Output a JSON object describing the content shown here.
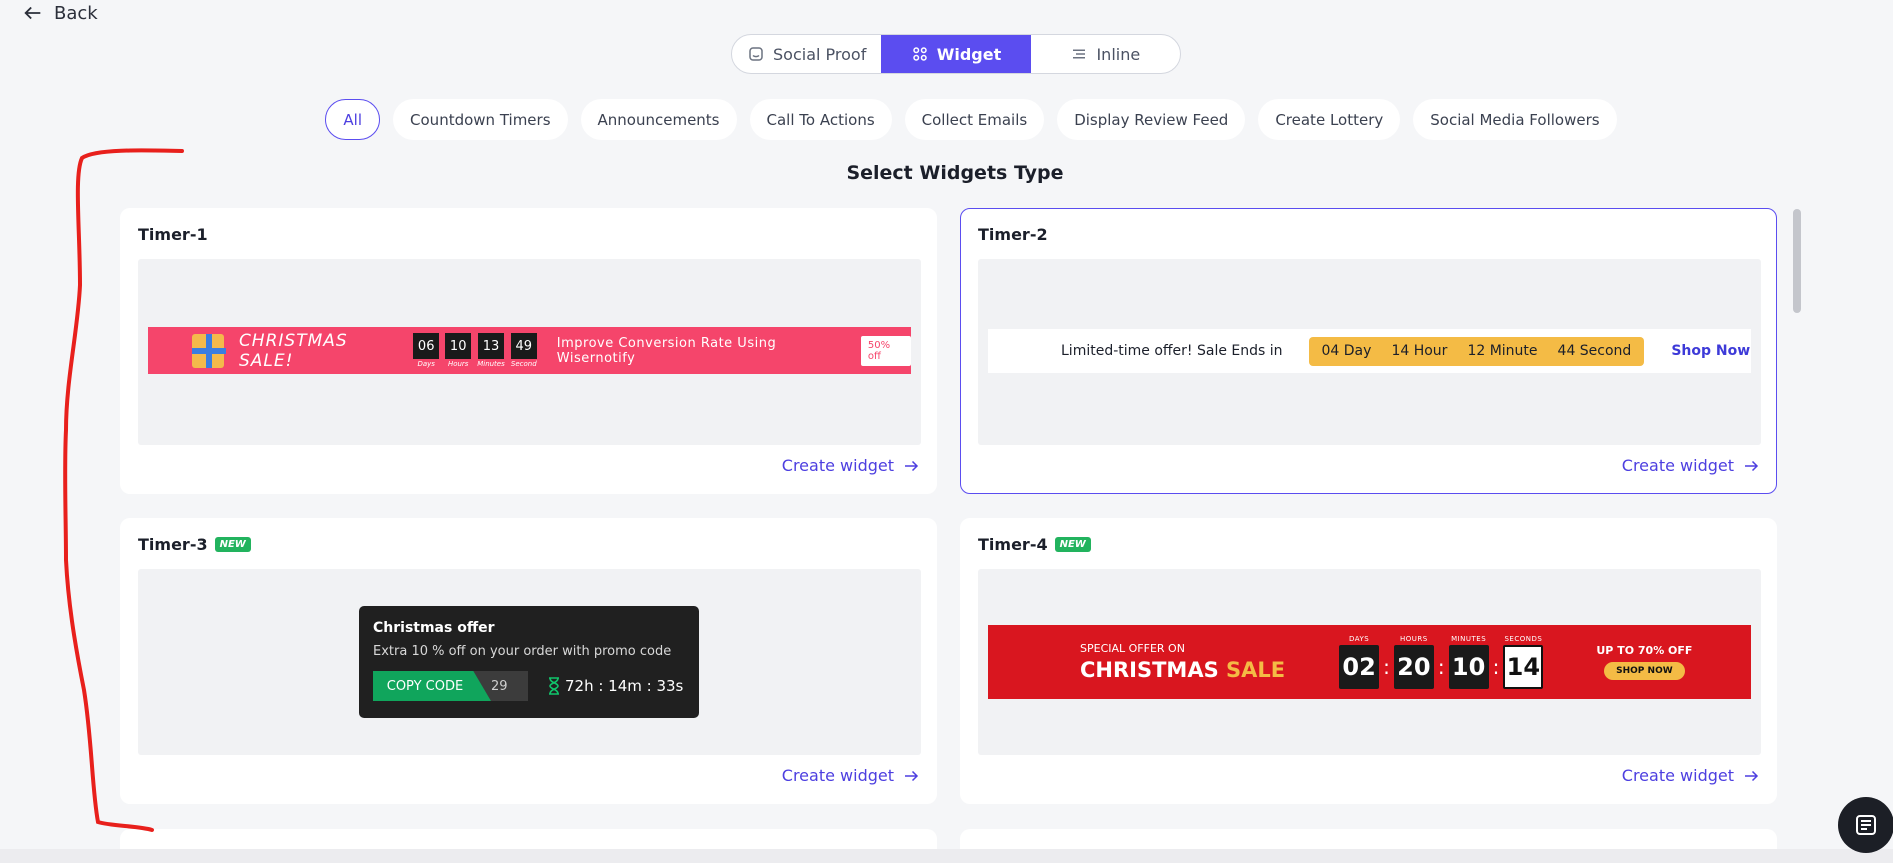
{
  "nav": {
    "back_label": "Back"
  },
  "segments": [
    {
      "label": "Social Proof",
      "icon": "social-proof-icon",
      "active": false
    },
    {
      "label": "Widget",
      "icon": "grid-icon",
      "active": true
    },
    {
      "label": "Inline",
      "icon": "inline-icon",
      "active": false
    }
  ],
  "filters": [
    "All",
    "Countdown Timers",
    "Announcements",
    "Call To Actions",
    "Collect Emails",
    "Display Review Feed",
    "Create Lottery",
    "Social Media Followers"
  ],
  "active_filter": "All",
  "heading": "Select Widgets Type",
  "cta_label": "Create widget",
  "cards": {
    "timer1": {
      "title": "Timer-1",
      "sale": "CHRISTMAS SALE!",
      "digits": [
        {
          "value": "06",
          "label": "Days"
        },
        {
          "value": "10",
          "label": "Hours"
        },
        {
          "value": "13",
          "label": "Minutes"
        },
        {
          "value": "49",
          "label": "Second"
        }
      ],
      "text": "Improve Conversion Rate Using Wisernotify",
      "button": "50% off"
    },
    "timer2": {
      "title": "Timer-2",
      "text": "Limited-time offer! Sale Ends in",
      "parts": [
        "04 Day",
        "14 Hour",
        "12 Minute",
        "44 Second"
      ],
      "shop": "Shop Now"
    },
    "timer3": {
      "title": "Timer-3",
      "badge": "NEW",
      "heading": "Christmas offer",
      "sub": "Extra 10 % off on your order with promo code",
      "copy": "COPY CODE",
      "code_tail": "29",
      "timer": "72h : 14m : 33s"
    },
    "timer4": {
      "title": "Timer-4",
      "badge": "NEW",
      "special": "SPECIAL OFFER ON",
      "christmas": "CHRISTMAS",
      "sale": "SALE",
      "units": [
        {
          "label": "DAYS",
          "value": "02"
        },
        {
          "label": "HOURS",
          "value": "20"
        },
        {
          "label": "MINUTES",
          "value": "10"
        },
        {
          "label": "SECONDS",
          "value": "14"
        }
      ],
      "upto": "UP TO 70% OFF",
      "shop": "SHOP NOW"
    }
  },
  "colors": {
    "accent": "#5b4df0",
    "timer1_bg": "#f5456b",
    "timer2_box": "#f4bb45",
    "timer4_bg": "#d9161f",
    "badge": "#22b35e",
    "annotation": "#e8201c"
  }
}
